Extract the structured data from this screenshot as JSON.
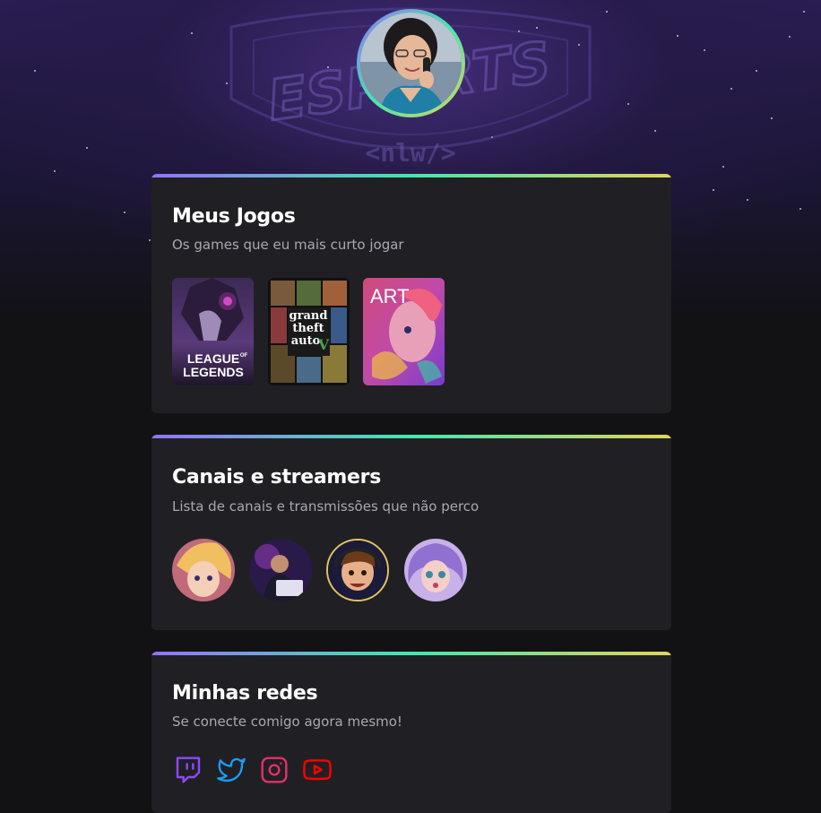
{
  "background": {
    "watermark_text": "ESPORTS",
    "watermark_sub": "<nlw/>"
  },
  "profile": {
    "avatar": "profile-photo"
  },
  "games_section": {
    "title": "Meus Jogos",
    "subtitle": "Os games que eu mais curto jogar",
    "games": [
      {
        "name": "league-of-legends",
        "logo_line1": "LEAGUE",
        "logo_of": "OF",
        "logo_line2": "LEGENDS"
      },
      {
        "name": "grand-theft-auto-v",
        "logo_line1": "grand",
        "logo_line2": "theft",
        "logo_line3": "auto",
        "logo_v": "V"
      },
      {
        "name": "art-game",
        "logo_text": "ART"
      }
    ]
  },
  "channels_section": {
    "title": "Canais e streamers",
    "subtitle": "Lista de canais e transmissões que não perco",
    "channels": [
      "channel-1",
      "channel-2",
      "channel-3",
      "channel-4"
    ]
  },
  "social_section": {
    "title": "Minhas redes",
    "subtitle": "Se conecte comigo agora mesmo!",
    "networks": [
      {
        "icon": "twitch-icon",
        "color": "#9146ff"
      },
      {
        "icon": "twitter-icon",
        "color": "#1d9bf0"
      },
      {
        "icon": "instagram-icon",
        "color": "#e1306c"
      },
      {
        "icon": "youtube-icon",
        "color": "#ff0000"
      }
    ]
  },
  "theme": {
    "gradient_start": "#9572fc",
    "gradient_mid": "#43e7ad",
    "gradient_end": "#e2d45c",
    "card_bg": "#202024",
    "page_bg": "#121214"
  }
}
